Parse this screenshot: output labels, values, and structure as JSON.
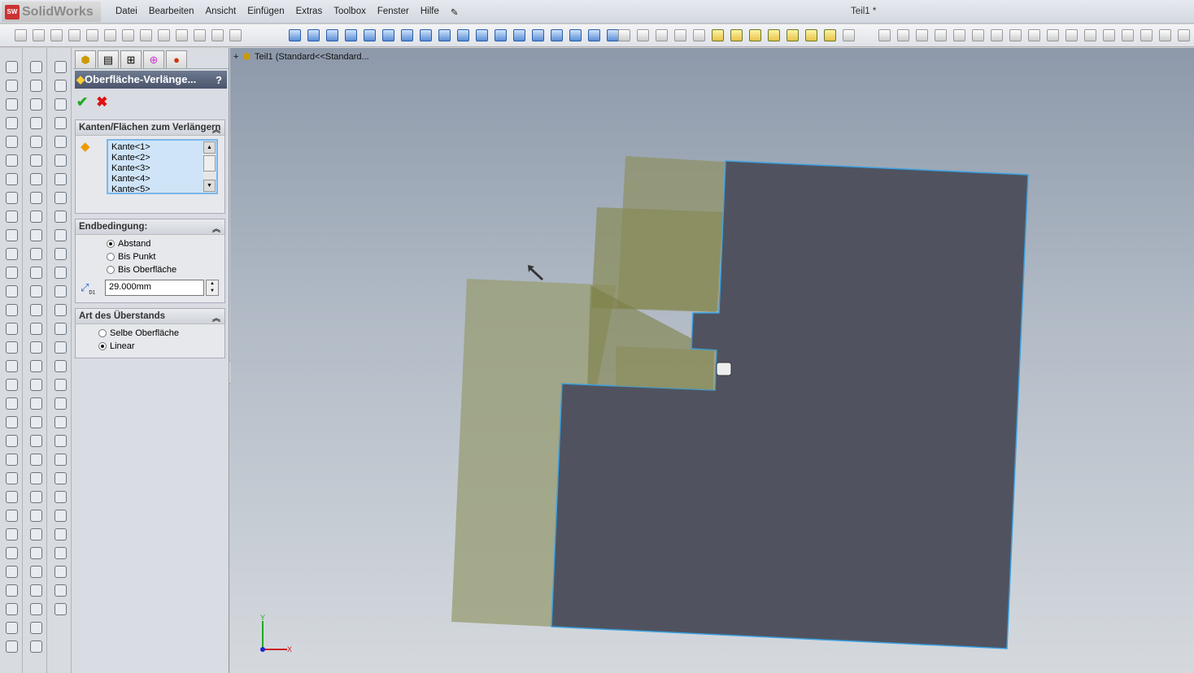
{
  "app": {
    "logo": "SolidWorks",
    "doc_title": "Teil1 *"
  },
  "menu": [
    "Datei",
    "Bearbeiten",
    "Ansicht",
    "Einfügen",
    "Extras",
    "Toolbox",
    "Fenster",
    "Hilfe"
  ],
  "panel": {
    "title": "Oberfläche-Verlänge...",
    "help": "?",
    "ok": "✔",
    "cancel": "✖",
    "group1": {
      "title": "Kanten/Flächen zum Verlängern",
      "items": [
        "Kante<1>",
        "Kante<2>",
        "Kante<3>",
        "Kante<4>",
        "Kante<5>"
      ]
    },
    "group2": {
      "title": "Endbedingung:",
      "options": [
        "Abstand",
        "Bis Punkt",
        "Bis Oberfläche"
      ],
      "selected": "Abstand",
      "distance_label": "D1",
      "distance": "29.000mm"
    },
    "group3": {
      "title": "Art des Überstands",
      "options": [
        "Selbe Oberfläche",
        "Linear"
      ],
      "selected": "Linear"
    }
  },
  "tree": {
    "root": "Teil1  (Standard<<Standard..."
  },
  "triad": {
    "x": "X",
    "y": "Y"
  }
}
